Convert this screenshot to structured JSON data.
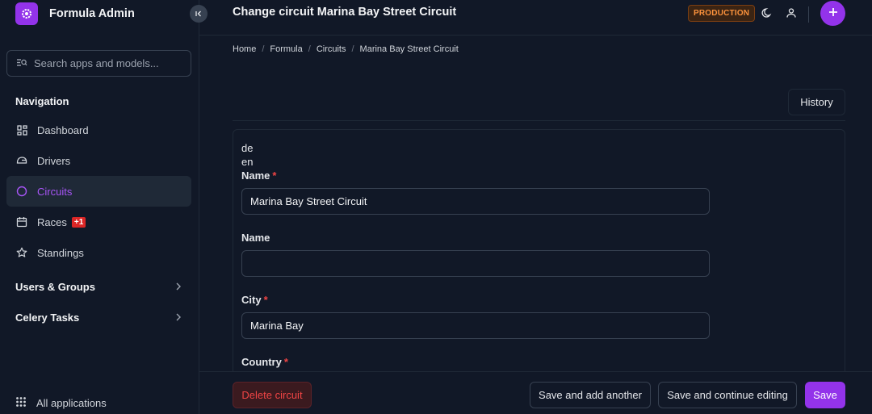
{
  "app": {
    "name": "Formula Admin"
  },
  "search": {
    "placeholder": "Search apps and models..."
  },
  "sidebar": {
    "navigation_heading": "Navigation",
    "items": [
      {
        "label": "Dashboard",
        "icon": "dashboard-icon"
      },
      {
        "label": "Drivers",
        "icon": "helmet-icon"
      },
      {
        "label": "Circuits",
        "icon": "circle-icon",
        "active": true
      },
      {
        "label": "Races",
        "icon": "calendar-icon",
        "badge": "+1"
      },
      {
        "label": "Standings",
        "icon": "star-icon"
      }
    ],
    "groups": [
      {
        "label": "Users & Groups"
      },
      {
        "label": "Celery Tasks"
      }
    ],
    "all_apps": "All applications"
  },
  "header": {
    "title": "Change circuit Marina Bay Street Circuit",
    "environment": "PRODUCTION"
  },
  "breadcrumb": [
    "Home",
    "Formula",
    "Circuits",
    "Marina Bay Street Circuit"
  ],
  "history_label": "History",
  "form": {
    "languages": [
      "de",
      "en"
    ],
    "fields": [
      {
        "label": "Name",
        "required": "*",
        "value": "Marina Bay Street Circuit"
      },
      {
        "label": "Name",
        "value": ""
      },
      {
        "label": "City",
        "required": "*",
        "value": "Marina Bay"
      },
      {
        "label": "Country",
        "required": "*"
      }
    ]
  },
  "footer": {
    "delete": "Delete circuit",
    "save_add": "Save and add another",
    "save_continue": "Save and continue editing",
    "save": "Save"
  },
  "colors": {
    "accent": "#9333ea",
    "active_text": "#a855f7",
    "danger": "#ef4444",
    "environment": "#fb923c",
    "background": "#111827"
  }
}
